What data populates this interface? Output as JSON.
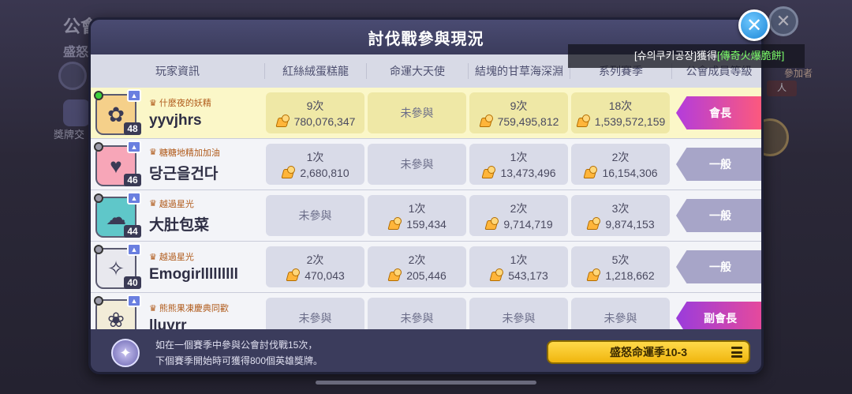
{
  "background": {
    "title": "公會",
    "subtitle": "盛怒",
    "medal_label": "獎牌交",
    "right_tag": "參加者",
    "right_badge": "人"
  },
  "dialog": {
    "title": "討伐戰參與現況",
    "close_icon": "close-icon"
  },
  "notice": {
    "prefix": "[슈의쿠키공장]獲得",
    "highlight": "[傳奇火爆脆餅]"
  },
  "columns": {
    "player": "玩家資訊",
    "c1": "紅絲絨蛋糕龍",
    "c2": "命運大天使",
    "c3": "結塊的甘草海深淵",
    "c4": "系列賽季",
    "rank": "公會成員等級"
  },
  "rows": [
    {
      "online": true,
      "level": "48",
      "title": "什麼夜的妖精",
      "name": "yyvjhrs",
      "c1": {
        "times": "9次",
        "score": "780,076,347"
      },
      "c2": {
        "none": "未參與"
      },
      "c3": {
        "times": "9次",
        "score": "759,495,812"
      },
      "c4": {
        "times": "18次",
        "score": "1,539,572,159"
      },
      "rank": "會長"
    },
    {
      "online": false,
      "level": "46",
      "title": "糖糖地精加加油",
      "name": "당근을건다",
      "c1": {
        "times": "1次",
        "score": "2,680,810"
      },
      "c2": {
        "none": "未參與"
      },
      "c3": {
        "times": "1次",
        "score": "13,473,496"
      },
      "c4": {
        "times": "2次",
        "score": "16,154,306"
      },
      "rank": "一般"
    },
    {
      "online": false,
      "level": "44",
      "title": "越過星光",
      "name": "大肚包菜",
      "c1": {
        "none": "未參與"
      },
      "c2": {
        "times": "1次",
        "score": "159,434"
      },
      "c3": {
        "times": "2次",
        "score": "9,714,719"
      },
      "c4": {
        "times": "3次",
        "score": "9,874,153"
      },
      "rank": "一般"
    },
    {
      "online": false,
      "level": "40",
      "title": "越過星光",
      "name": "Emogirlllllllll",
      "c1": {
        "times": "2次",
        "score": "470,043"
      },
      "c2": {
        "times": "2次",
        "score": "205,446"
      },
      "c3": {
        "times": "1次",
        "score": "543,173"
      },
      "c4": {
        "times": "5次",
        "score": "1,218,662"
      },
      "rank": "一般"
    },
    {
      "online": false,
      "level": "",
      "title": "熊熊果凍慶典同歡",
      "name": "lluyrr",
      "c1": {
        "none": "未參與"
      },
      "c2": {
        "none": "未參與"
      },
      "c3": {
        "none": "未參與"
      },
      "c4": {
        "none": "未參與"
      },
      "rank": "副會長"
    }
  ],
  "footer": {
    "line1": "如在一個賽季中參與公會討伐戰15次，",
    "line2": "下個賽季開始時可獲得800個英雄獎牌。",
    "season_button": "盛怒命運季10-3"
  },
  "colors": {
    "leader": "#ff5a7a",
    "normal": "#a7a5c8",
    "highlight_row": "#fbf7c8",
    "season_button": "#f0b60e"
  }
}
